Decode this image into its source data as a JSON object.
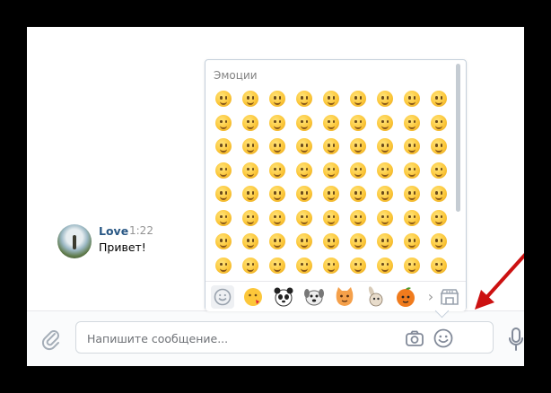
{
  "message": {
    "author": "Love",
    "time": "1:22",
    "text": "Привет!"
  },
  "input": {
    "placeholder": "Напишите сообщение..."
  },
  "emoji_panel": {
    "title": "Эмоции",
    "tabs": [
      {
        "icon": "smile-outline-icon",
        "label": ""
      },
      {
        "icon": "sticker-emoji-kiss",
        "label": ""
      },
      {
        "icon": "sticker-panda",
        "label": ""
      },
      {
        "icon": "sticker-dog",
        "label": ""
      },
      {
        "icon": "sticker-cat",
        "label": ""
      },
      {
        "icon": "sticker-rabbit",
        "label": ""
      },
      {
        "icon": "sticker-orange",
        "label": ""
      }
    ],
    "more_label": "›",
    "store_icon": "sticker-store-icon",
    "rows": 8,
    "cols": 9
  },
  "colors": {
    "accent": "#2a5885",
    "arrow": "#cc1111",
    "emoji": "#fcc73a"
  }
}
